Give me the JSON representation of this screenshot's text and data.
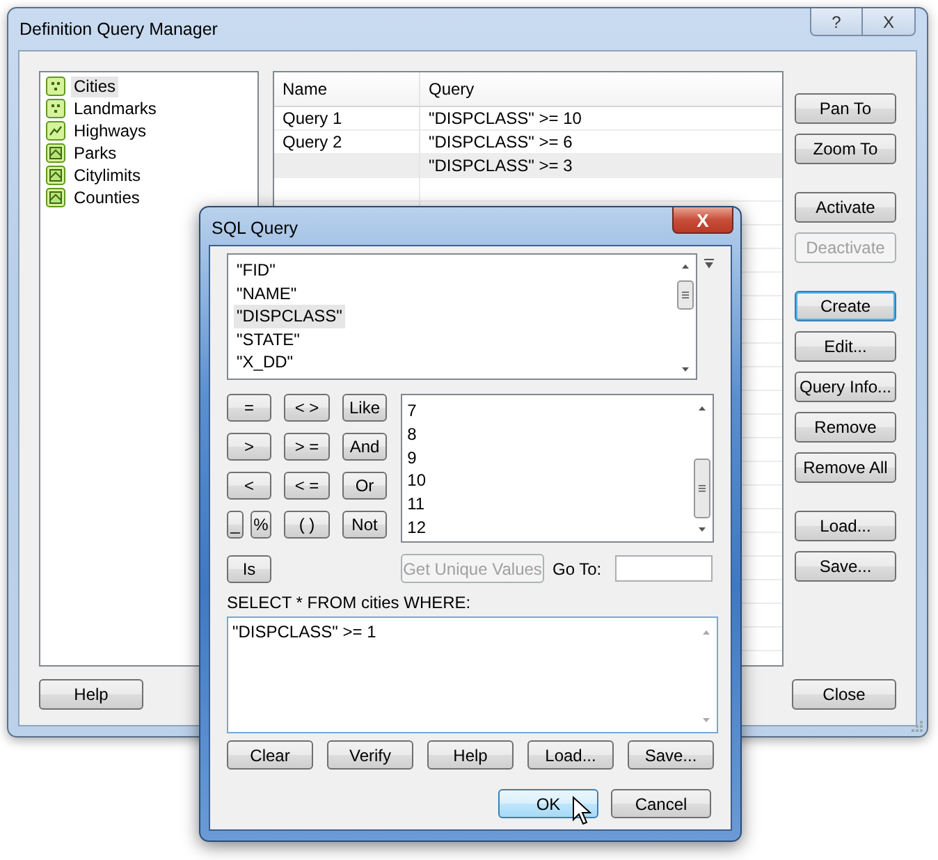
{
  "window": {
    "title": "Definition Query Manager",
    "help_glyph": "?",
    "close_glyph": "X"
  },
  "layers": [
    {
      "label": "Cities",
      "kind": "point",
      "selected": true
    },
    {
      "label": "Landmarks",
      "kind": "point",
      "selected": false
    },
    {
      "label": "Highways",
      "kind": "line",
      "selected": false
    },
    {
      "label": "Parks",
      "kind": "polygon",
      "selected": false
    },
    {
      "label": "Citylimits",
      "kind": "polygon",
      "selected": false
    },
    {
      "label": "Counties",
      "kind": "polygon",
      "selected": false
    }
  ],
  "table": {
    "columns": [
      "Name",
      "Query"
    ],
    "rows": [
      {
        "cells": [
          "Query 1",
          "\"DISPCLASS\" >= 10"
        ],
        "selected": false
      },
      {
        "cells": [
          "Query 2",
          "\"DISPCLASS\" >= 6"
        ],
        "selected": false
      },
      {
        "cells": [
          "",
          "\"DISPCLASS\" >= 3"
        ],
        "selected": true
      }
    ]
  },
  "button_groups": [
    [
      {
        "label": "Pan To",
        "disabled": false,
        "default": false
      },
      {
        "label": "Zoom To",
        "disabled": false,
        "default": false
      }
    ],
    [
      {
        "label": "Activate",
        "disabled": false,
        "default": false
      },
      {
        "label": "Deactivate",
        "disabled": true,
        "default": false
      }
    ],
    [
      {
        "label": "Create",
        "disabled": false,
        "default": true
      },
      {
        "label": "Edit...",
        "disabled": false,
        "default": false
      },
      {
        "label": "Query Info...",
        "disabled": false,
        "default": false
      },
      {
        "label": "Remove",
        "disabled": false,
        "default": false
      },
      {
        "label": "Remove All",
        "disabled": false,
        "default": false
      }
    ],
    [
      {
        "label": "Load...",
        "disabled": false,
        "default": false
      },
      {
        "label": "Save...",
        "disabled": false,
        "default": false
      }
    ]
  ],
  "help_button": "Help",
  "close_button": "Close",
  "sql_dialog": {
    "title": "SQL Query",
    "close_glyph": "X",
    "fields": [
      {
        "label": "\"FID\"",
        "selected": false
      },
      {
        "label": "\"NAME\"",
        "selected": false
      },
      {
        "label": "\"DISPCLASS\"",
        "selected": true
      },
      {
        "label": "\"STATE\"",
        "selected": false
      },
      {
        "label": "\"X_DD\"",
        "selected": false
      }
    ],
    "operators": [
      [
        "=",
        "< >",
        "Like"
      ],
      [
        ">",
        "> =",
        "And"
      ],
      [
        "<",
        "< =",
        "Or"
      ]
    ],
    "operators_last_row": [
      "_",
      "%",
      "( )",
      "Not"
    ],
    "is_button": "Is",
    "values": [
      "7",
      "8",
      "9",
      "10",
      "11",
      "12"
    ],
    "unique_button": {
      "label": "Get Unique Values",
      "disabled": true
    },
    "goto_label": "Go To:",
    "where_label": "SELECT * FROM cities WHERE:",
    "expression": "\"DISPCLASS\" >= 1",
    "buttons": [
      "Clear",
      "Verify",
      "Help",
      "Load...",
      "Save..."
    ],
    "ok_button": "OK",
    "cancel_button": "Cancel"
  }
}
